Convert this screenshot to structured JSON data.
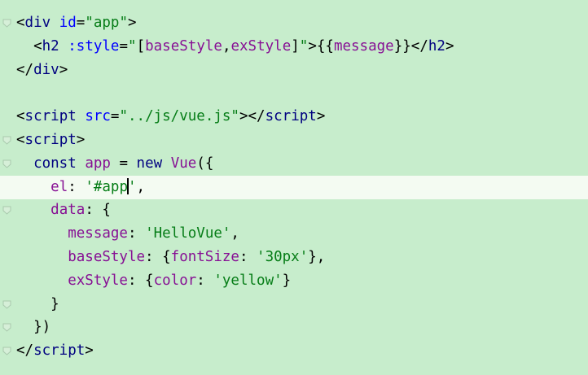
{
  "editor": {
    "lines": [
      {
        "indent": "",
        "t": [
          {
            "k": "punct",
            "v": "<"
          },
          {
            "k": "tag",
            "v": "div"
          },
          {
            "k": "punct",
            "v": " "
          },
          {
            "k": "attr",
            "v": "id"
          },
          {
            "k": "punct",
            "v": "="
          },
          {
            "k": "str",
            "v": "\"app\""
          },
          {
            "k": "punct",
            "v": ">"
          }
        ]
      },
      {
        "indent": "  ",
        "t": [
          {
            "k": "punct",
            "v": "<"
          },
          {
            "k": "tag",
            "v": "h2"
          },
          {
            "k": "punct",
            "v": " "
          },
          {
            "k": "attr",
            "v": ":style"
          },
          {
            "k": "punct",
            "v": "="
          },
          {
            "k": "str",
            "v": "\""
          },
          {
            "k": "punct",
            "v": "["
          },
          {
            "k": "var",
            "v": "baseStyle"
          },
          {
            "k": "punct",
            "v": ","
          },
          {
            "k": "var",
            "v": "exStyle"
          },
          {
            "k": "punct",
            "v": "]"
          },
          {
            "k": "str",
            "v": "\""
          },
          {
            "k": "punct",
            "v": ">{{"
          },
          {
            "k": "var",
            "v": "message"
          },
          {
            "k": "punct",
            "v": "}}</"
          },
          {
            "k": "tag",
            "v": "h2"
          },
          {
            "k": "punct",
            "v": ">"
          }
        ]
      },
      {
        "indent": "",
        "t": [
          {
            "k": "punct",
            "v": "</"
          },
          {
            "k": "tag",
            "v": "div"
          },
          {
            "k": "punct",
            "v": ">"
          }
        ]
      },
      {
        "indent": "",
        "t": []
      },
      {
        "indent": "",
        "t": [
          {
            "k": "punct",
            "v": "<"
          },
          {
            "k": "tag",
            "v": "script"
          },
          {
            "k": "punct",
            "v": " "
          },
          {
            "k": "attr",
            "v": "src"
          },
          {
            "k": "punct",
            "v": "="
          },
          {
            "k": "str",
            "v": "\"../js/vue.js\""
          },
          {
            "k": "punct",
            "v": "></"
          },
          {
            "k": "tag",
            "v": "script"
          },
          {
            "k": "punct",
            "v": ">"
          }
        ]
      },
      {
        "indent": "",
        "t": [
          {
            "k": "punct",
            "v": "<"
          },
          {
            "k": "tag",
            "v": "script"
          },
          {
            "k": "punct",
            "v": ">"
          }
        ]
      },
      {
        "indent": "  ",
        "t": [
          {
            "k": "kw",
            "v": "const"
          },
          {
            "k": "punct",
            "v": " "
          },
          {
            "k": "var",
            "v": "app"
          },
          {
            "k": "punct",
            "v": " = "
          },
          {
            "k": "kw",
            "v": "new"
          },
          {
            "k": "punct",
            "v": " "
          },
          {
            "k": "fn",
            "v": "Vue"
          },
          {
            "k": "punct",
            "v": "({"
          }
        ]
      },
      {
        "indent": "    ",
        "current": true,
        "t": [
          {
            "k": "prop",
            "v": "el"
          },
          {
            "k": "punct",
            "v": ": "
          },
          {
            "k": "str",
            "v": "'#app"
          },
          {
            "k": "caret",
            "v": ""
          },
          {
            "k": "str",
            "v": "'"
          },
          {
            "k": "punct",
            "v": ","
          }
        ]
      },
      {
        "indent": "    ",
        "t": [
          {
            "k": "prop",
            "v": "data"
          },
          {
            "k": "punct",
            "v": ": {"
          }
        ]
      },
      {
        "indent": "      ",
        "t": [
          {
            "k": "prop",
            "v": "message"
          },
          {
            "k": "punct",
            "v": ": "
          },
          {
            "k": "str",
            "v": "'HelloVue'"
          },
          {
            "k": "punct",
            "v": ","
          }
        ]
      },
      {
        "indent": "      ",
        "t": [
          {
            "k": "prop",
            "v": "baseStyle"
          },
          {
            "k": "punct",
            "v": ": {"
          },
          {
            "k": "prop",
            "v": "fontSize"
          },
          {
            "k": "punct",
            "v": ": "
          },
          {
            "k": "str",
            "v": "'30px'"
          },
          {
            "k": "punct",
            "v": "},"
          }
        ]
      },
      {
        "indent": "      ",
        "t": [
          {
            "k": "prop",
            "v": "exStyle"
          },
          {
            "k": "punct",
            "v": ": {"
          },
          {
            "k": "prop",
            "v": "color"
          },
          {
            "k": "punct",
            "v": ": "
          },
          {
            "k": "str",
            "v": "'yellow'"
          },
          {
            "k": "punct",
            "v": "}"
          }
        ]
      },
      {
        "indent": "    ",
        "t": [
          {
            "k": "punct",
            "v": "}"
          }
        ]
      },
      {
        "indent": "  ",
        "t": [
          {
            "k": "punct",
            "v": "})"
          }
        ]
      },
      {
        "indent": "",
        "t": [
          {
            "k": "punct",
            "v": "</"
          },
          {
            "k": "tag",
            "v": "script"
          },
          {
            "k": "punct",
            "v": ">"
          }
        ]
      }
    ],
    "fold_markers": [
      0,
      5,
      6,
      8,
      12,
      13,
      14
    ],
    "colors": {
      "background": "#c7edcc",
      "current_line": "#f4fbf2",
      "tag": "#000080",
      "attribute": "#0000ff",
      "string": "#067d17",
      "property": "#871094"
    }
  }
}
